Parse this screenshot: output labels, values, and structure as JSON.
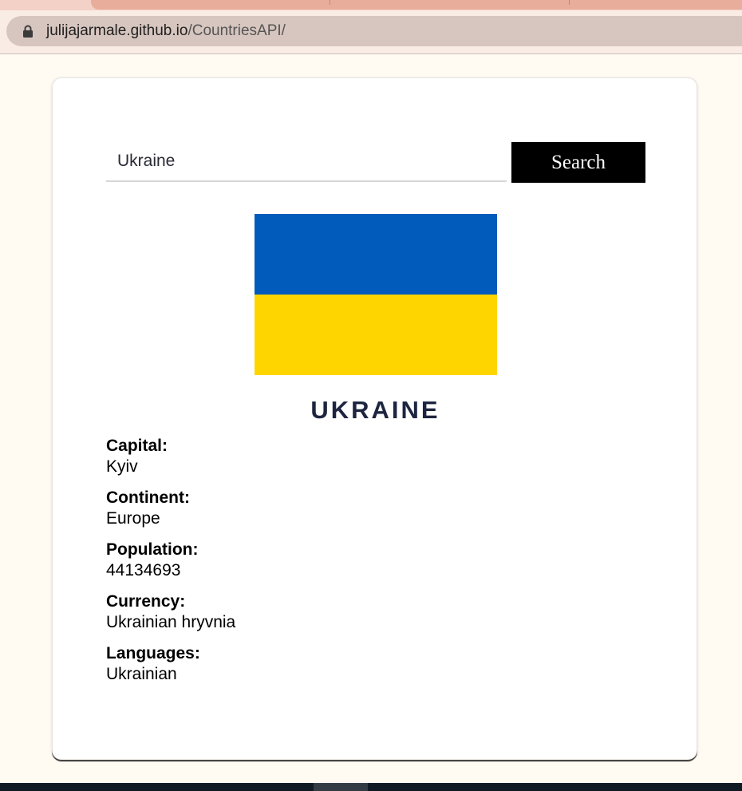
{
  "browser": {
    "url_host": "julijajarmale.github.io",
    "url_path": "/CountriesAPI/"
  },
  "search": {
    "value": "Ukraine",
    "button_label": "Search"
  },
  "flag": {
    "colors": [
      "#005bbb",
      "#ffd500"
    ]
  },
  "country": {
    "name": "UKRAINE",
    "fields": [
      {
        "label": "Capital:",
        "value": "Kyiv"
      },
      {
        "label": "Continent:",
        "value": "Europe"
      },
      {
        "label": "Population:",
        "value": "44134693"
      },
      {
        "label": "Currency:",
        "value": "Ukrainian hryvnia"
      },
      {
        "label": "Languages:",
        "value": "Ukrainian"
      }
    ]
  }
}
